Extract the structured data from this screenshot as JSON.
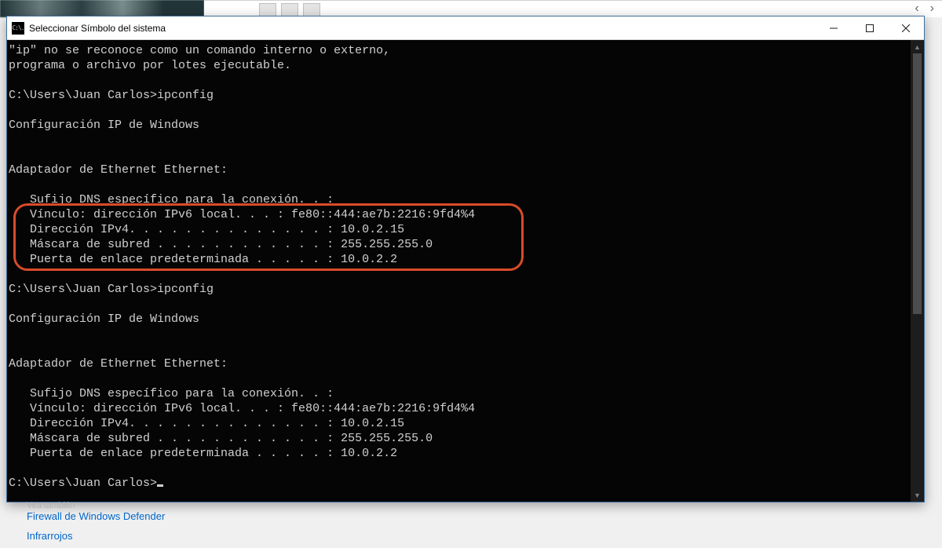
{
  "backdrop": {
    "chev_left": "‹",
    "chev_right": "›"
  },
  "window": {
    "icon_text": "C:\\.",
    "title": "Seleccionar Símbolo del sistema"
  },
  "console": {
    "lines": [
      "\"ip\" no se reconoce como un comando interno o externo,",
      "programa o archivo por lotes ejecutable.",
      "",
      "C:\\Users\\Juan Carlos>ipconfig",
      "",
      "Configuración IP de Windows",
      "",
      "",
      "Adaptador de Ethernet Ethernet:",
      "",
      "   Sufijo DNS específico para la conexión. . :",
      "   Vínculo: dirección IPv6 local. . . : fe80::444:ae7b:2216:9fd4%4",
      "   Dirección IPv4. . . . . . . . . . . . . . : 10.0.2.15",
      "   Máscara de subred . . . . . . . . . . . . : 255.255.255.0",
      "   Puerta de enlace predeterminada . . . . . : 10.0.2.2",
      "",
      "C:\\Users\\Juan Carlos>ipconfig",
      "",
      "Configuración IP de Windows",
      "",
      "",
      "Adaptador de Ethernet Ethernet:",
      "",
      "   Sufijo DNS específico para la conexión. . :",
      "   Vínculo: dirección IPv6 local. . . : fe80::444:ae7b:2216:9fd4%4",
      "   Dirección IPv4. . . . . . . . . . . . . . : 10.0.2.15",
      "   Máscara de subred . . . . . . . . . . . . : 255.255.255.0",
      "   Puerta de enlace predeterminada . . . . . : 10.0.2.2",
      ""
    ],
    "prompt": "C:\\Users\\Juan Carlos>"
  },
  "settings": {
    "see_also": "Vea también",
    "link1": "Firewall de Windows Defender",
    "link2": "Infrarrojos"
  }
}
